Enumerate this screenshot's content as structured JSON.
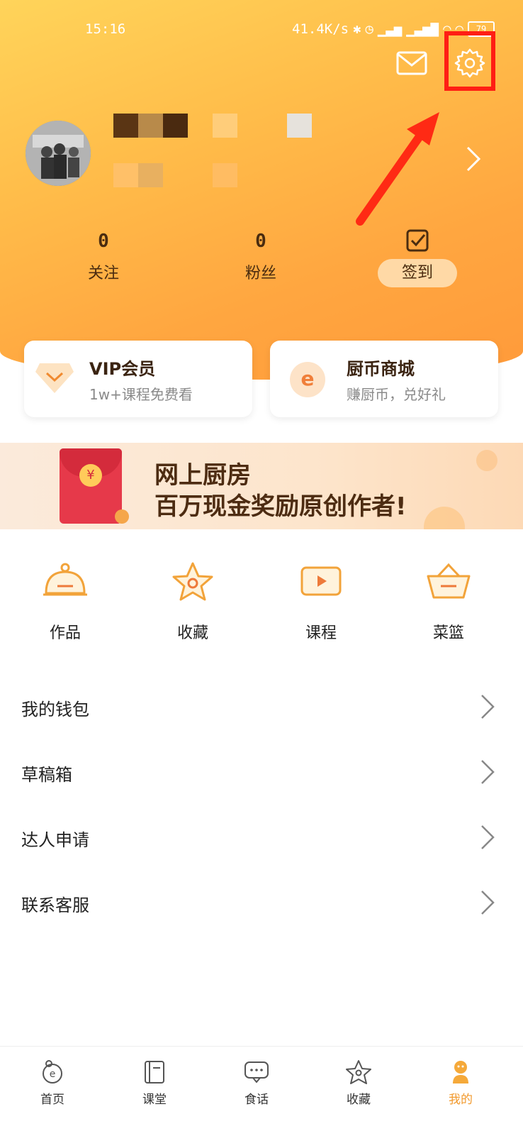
{
  "status_bar": {
    "time": "15:16",
    "network_speed": "41.4K/s",
    "battery": "79"
  },
  "header": {
    "icons": [
      "mail-icon",
      "gear-icon"
    ],
    "stats": [
      {
        "value": "0",
        "label": "关注"
      },
      {
        "value": "0",
        "label": "粉丝"
      }
    ],
    "signin_label": "签到"
  },
  "cards": [
    {
      "title": "VIP会员",
      "subtitle": "1w+课程免费看",
      "icon": "diamond-icon"
    },
    {
      "title": "厨币商城",
      "subtitle": "赚厨币，兑好礼",
      "icon": "coin-e-icon"
    }
  ],
  "banner": {
    "line1": "网上厨房",
    "line2": "百万现金奖励原创作者!"
  },
  "quick_actions": [
    {
      "label": "作品",
      "icon": "cloche-icon"
    },
    {
      "label": "收藏",
      "icon": "star-icon"
    },
    {
      "label": "课程",
      "icon": "play-icon"
    },
    {
      "label": "菜篮",
      "icon": "basket-icon"
    }
  ],
  "menu": [
    {
      "label": "我的钱包"
    },
    {
      "label": "草稿箱"
    },
    {
      "label": "达人申请"
    },
    {
      "label": "联系客服"
    }
  ],
  "tabbar": [
    {
      "label": "首页",
      "icon": "home-icon"
    },
    {
      "label": "课堂",
      "icon": "book-icon"
    },
    {
      "label": "食话",
      "icon": "chat-icon"
    },
    {
      "label": "收藏",
      "icon": "star-icon"
    },
    {
      "label": "我的",
      "icon": "profile-icon"
    }
  ],
  "colors": {
    "header_start": "#ffd45a",
    "header_end": "#ff9a3a",
    "accent": "#f2a33a",
    "highlight_red": "#ff1e14"
  }
}
